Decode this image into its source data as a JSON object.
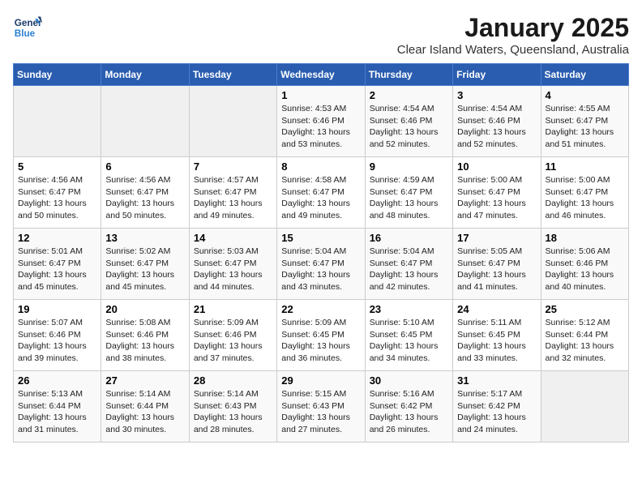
{
  "logo": {
    "line1": "General",
    "line2": "Blue"
  },
  "title": "January 2025",
  "location": "Clear Island Waters, Queensland, Australia",
  "days_of_week": [
    "Sunday",
    "Monday",
    "Tuesday",
    "Wednesday",
    "Thursday",
    "Friday",
    "Saturday"
  ],
  "weeks": [
    [
      {
        "day": "",
        "info": ""
      },
      {
        "day": "",
        "info": ""
      },
      {
        "day": "",
        "info": ""
      },
      {
        "day": "1",
        "info": "Sunrise: 4:53 AM\nSunset: 6:46 PM\nDaylight: 13 hours\nand 53 minutes."
      },
      {
        "day": "2",
        "info": "Sunrise: 4:54 AM\nSunset: 6:46 PM\nDaylight: 13 hours\nand 52 minutes."
      },
      {
        "day": "3",
        "info": "Sunrise: 4:54 AM\nSunset: 6:46 PM\nDaylight: 13 hours\nand 52 minutes."
      },
      {
        "day": "4",
        "info": "Sunrise: 4:55 AM\nSunset: 6:47 PM\nDaylight: 13 hours\nand 51 minutes."
      }
    ],
    [
      {
        "day": "5",
        "info": "Sunrise: 4:56 AM\nSunset: 6:47 PM\nDaylight: 13 hours\nand 50 minutes."
      },
      {
        "day": "6",
        "info": "Sunrise: 4:56 AM\nSunset: 6:47 PM\nDaylight: 13 hours\nand 50 minutes."
      },
      {
        "day": "7",
        "info": "Sunrise: 4:57 AM\nSunset: 6:47 PM\nDaylight: 13 hours\nand 49 minutes."
      },
      {
        "day": "8",
        "info": "Sunrise: 4:58 AM\nSunset: 6:47 PM\nDaylight: 13 hours\nand 49 minutes."
      },
      {
        "day": "9",
        "info": "Sunrise: 4:59 AM\nSunset: 6:47 PM\nDaylight: 13 hours\nand 48 minutes."
      },
      {
        "day": "10",
        "info": "Sunrise: 5:00 AM\nSunset: 6:47 PM\nDaylight: 13 hours\nand 47 minutes."
      },
      {
        "day": "11",
        "info": "Sunrise: 5:00 AM\nSunset: 6:47 PM\nDaylight: 13 hours\nand 46 minutes."
      }
    ],
    [
      {
        "day": "12",
        "info": "Sunrise: 5:01 AM\nSunset: 6:47 PM\nDaylight: 13 hours\nand 45 minutes."
      },
      {
        "day": "13",
        "info": "Sunrise: 5:02 AM\nSunset: 6:47 PM\nDaylight: 13 hours\nand 45 minutes."
      },
      {
        "day": "14",
        "info": "Sunrise: 5:03 AM\nSunset: 6:47 PM\nDaylight: 13 hours\nand 44 minutes."
      },
      {
        "day": "15",
        "info": "Sunrise: 5:04 AM\nSunset: 6:47 PM\nDaylight: 13 hours\nand 43 minutes."
      },
      {
        "day": "16",
        "info": "Sunrise: 5:04 AM\nSunset: 6:47 PM\nDaylight: 13 hours\nand 42 minutes."
      },
      {
        "day": "17",
        "info": "Sunrise: 5:05 AM\nSunset: 6:47 PM\nDaylight: 13 hours\nand 41 minutes."
      },
      {
        "day": "18",
        "info": "Sunrise: 5:06 AM\nSunset: 6:46 PM\nDaylight: 13 hours\nand 40 minutes."
      }
    ],
    [
      {
        "day": "19",
        "info": "Sunrise: 5:07 AM\nSunset: 6:46 PM\nDaylight: 13 hours\nand 39 minutes."
      },
      {
        "day": "20",
        "info": "Sunrise: 5:08 AM\nSunset: 6:46 PM\nDaylight: 13 hours\nand 38 minutes."
      },
      {
        "day": "21",
        "info": "Sunrise: 5:09 AM\nSunset: 6:46 PM\nDaylight: 13 hours\nand 37 minutes."
      },
      {
        "day": "22",
        "info": "Sunrise: 5:09 AM\nSunset: 6:45 PM\nDaylight: 13 hours\nand 36 minutes."
      },
      {
        "day": "23",
        "info": "Sunrise: 5:10 AM\nSunset: 6:45 PM\nDaylight: 13 hours\nand 34 minutes."
      },
      {
        "day": "24",
        "info": "Sunrise: 5:11 AM\nSunset: 6:45 PM\nDaylight: 13 hours\nand 33 minutes."
      },
      {
        "day": "25",
        "info": "Sunrise: 5:12 AM\nSunset: 6:44 PM\nDaylight: 13 hours\nand 32 minutes."
      }
    ],
    [
      {
        "day": "26",
        "info": "Sunrise: 5:13 AM\nSunset: 6:44 PM\nDaylight: 13 hours\nand 31 minutes."
      },
      {
        "day": "27",
        "info": "Sunrise: 5:14 AM\nSunset: 6:44 PM\nDaylight: 13 hours\nand 30 minutes."
      },
      {
        "day": "28",
        "info": "Sunrise: 5:14 AM\nSunset: 6:43 PM\nDaylight: 13 hours\nand 28 minutes."
      },
      {
        "day": "29",
        "info": "Sunrise: 5:15 AM\nSunset: 6:43 PM\nDaylight: 13 hours\nand 27 minutes."
      },
      {
        "day": "30",
        "info": "Sunrise: 5:16 AM\nSunset: 6:42 PM\nDaylight: 13 hours\nand 26 minutes."
      },
      {
        "day": "31",
        "info": "Sunrise: 5:17 AM\nSunset: 6:42 PM\nDaylight: 13 hours\nand 24 minutes."
      },
      {
        "day": "",
        "info": ""
      }
    ]
  ]
}
